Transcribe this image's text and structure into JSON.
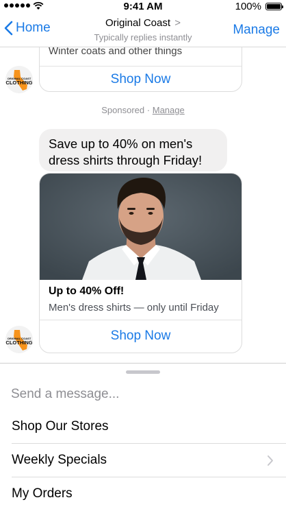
{
  "status_bar": {
    "time": "9:41 AM",
    "battery": "100%"
  },
  "nav": {
    "back_label": "Home",
    "title": "Original Coast",
    "title_chevron": ">",
    "subtitle": "Typically replies instantly",
    "manage_label": "Manage"
  },
  "brand": {
    "logo_line1": "ORIGINAL COAST",
    "logo_line2": "CLOTHING",
    "accent": "#f7941d"
  },
  "chat": {
    "prev_card": {
      "text": "Winter coats and other things",
      "button": "Shop Now"
    },
    "sponsored": {
      "label": "Sponsored",
      "separator": "·",
      "manage": "Manage"
    },
    "message": "Save up to 40% on men's dress shirts through Friday!",
    "ad_card": {
      "title": "Up to 40% Off!",
      "subtitle": "Men's dress shirts — only until Friday",
      "button": "Shop Now"
    }
  },
  "composer": {
    "placeholder": "Send a message...",
    "menu": [
      {
        "label": "Shop Our Stores"
      },
      {
        "label": "Weekly Specials",
        "has_submenu": true
      },
      {
        "label": "My Orders"
      }
    ]
  },
  "colors": {
    "link": "#1a7ae6",
    "bubble": "#f1f0f0",
    "muted": "#8e8e93"
  }
}
